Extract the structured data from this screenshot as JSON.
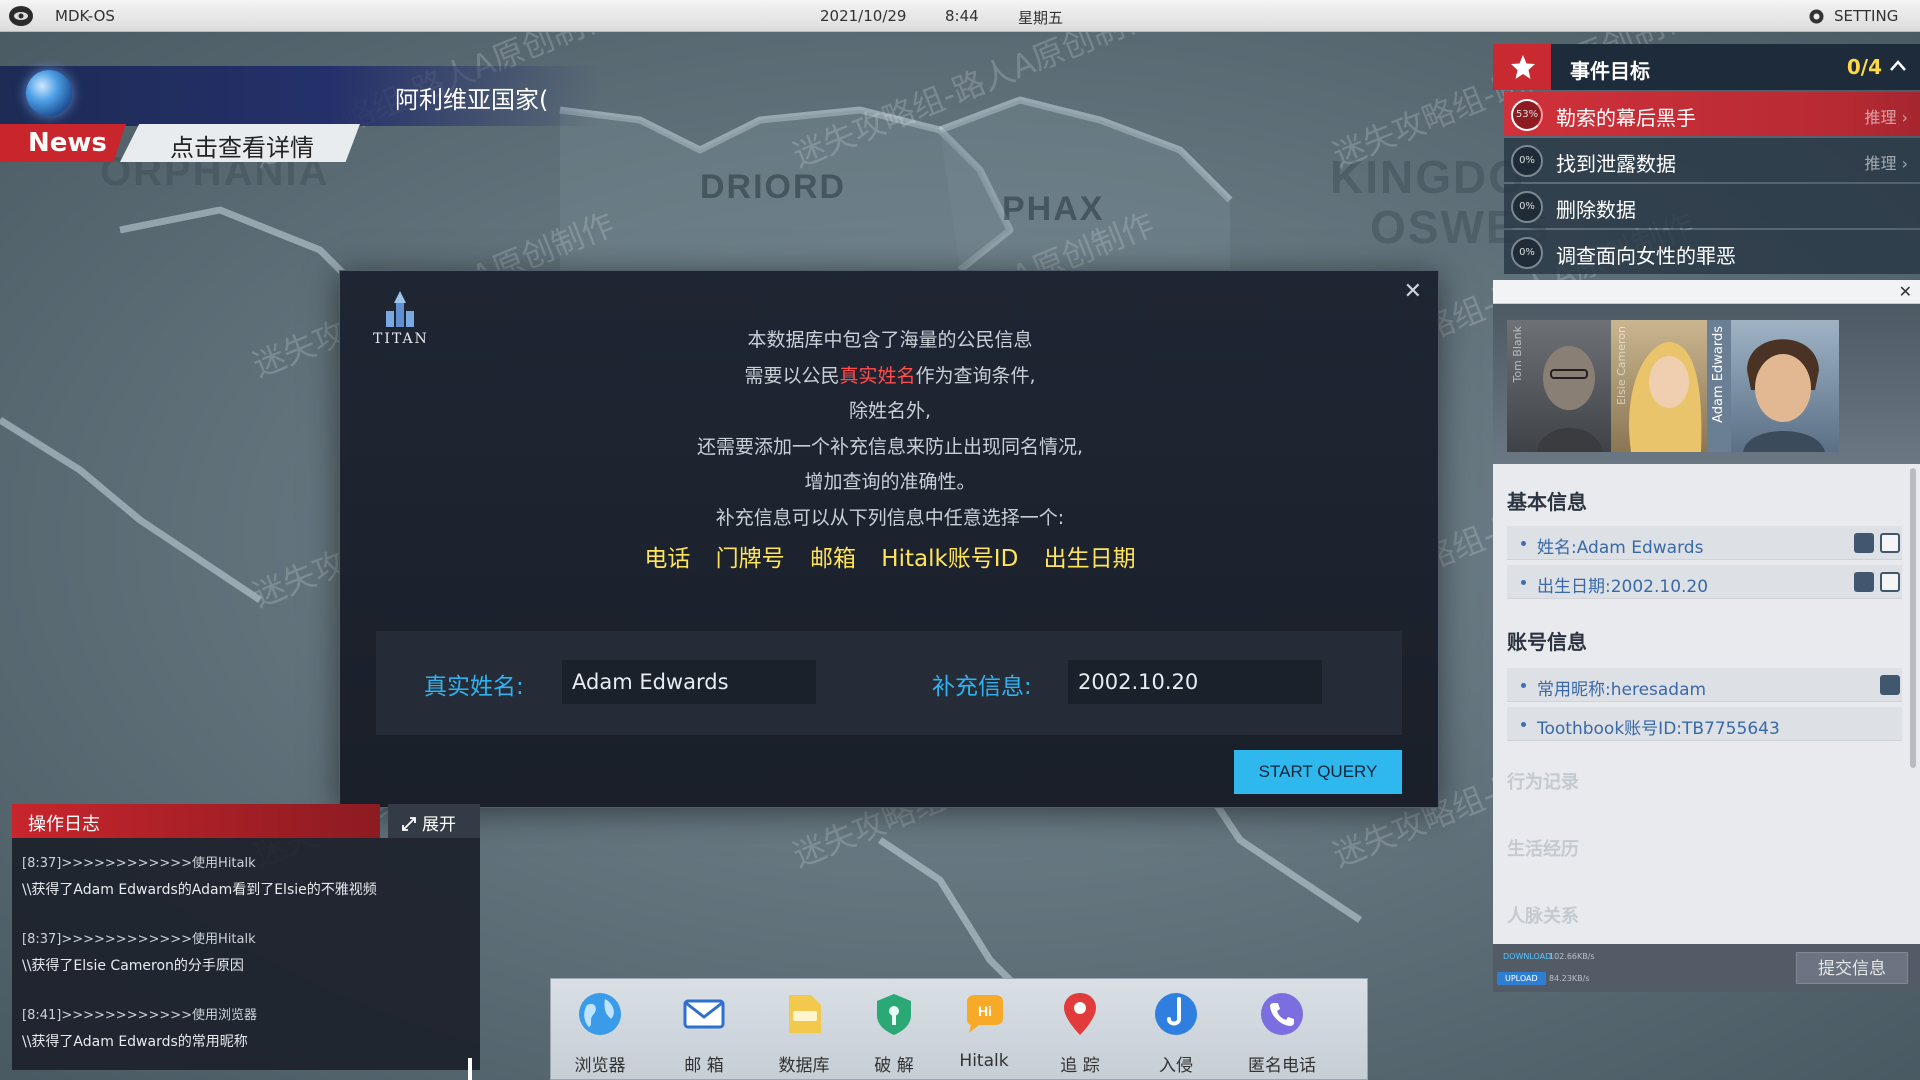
{
  "topbar": {
    "os_name": "MDK-OS",
    "date": "2021/10/29",
    "time": "8:44",
    "weekday": "星期五",
    "setting": "SETTING"
  },
  "news": {
    "headline": "阿利维亚国家(",
    "tag": "News",
    "detail": "点击查看详情"
  },
  "map_labels": [
    "DRIORD",
    "PHAX",
    "KINGDO",
    "OSWES",
    "ORPHANIA"
  ],
  "watermark": "迷失攻略组-路人A原创制作",
  "objectives": {
    "title": "事件目标",
    "count": "0/4",
    "items": [
      {
        "pct": "53%",
        "label": "勒索的幕后黑手",
        "action": "推理",
        "active": true
      },
      {
        "pct": "0%",
        "label": "找到泄露数据",
        "action": "推理",
        "active": false
      },
      {
        "pct": "0%",
        "label": "删除数据",
        "action": "",
        "active": false
      },
      {
        "pct": "0%",
        "label": "调查面向女性的罪恶",
        "action": "",
        "active": false
      }
    ]
  },
  "profile": {
    "portraits": [
      "Tom Blank",
      "Elsie Cameron",
      "Adam Edwards"
    ],
    "basic_title": "基本信息",
    "basic_items": [
      "姓名:Adam Edwards",
      "出生日期:2002.10.20"
    ],
    "account_title": "账号信息",
    "account_items": [
      "常用昵称:heresadam",
      "Toothbook账号ID:TB7755643"
    ],
    "faded_sections": [
      "行为记录",
      "生活经历",
      "人脉关系"
    ],
    "download_label": "DOWNLOAD",
    "download_rate": "102.66KB/s",
    "upload_label": "UPLOAD",
    "upload_rate": "84.23KB/s",
    "submit": "提交信息"
  },
  "modal": {
    "logo_text": "TITAN",
    "intro_lines": [
      "本数据库中包含了海量的公民信息",
      "除姓名外,",
      "还需要添加一个补充信息来防止出现同名情况,",
      "增加查询的准确性。",
      "补充信息可以从下列信息中任意选择一个:"
    ],
    "line2_pre": "需要以公民",
    "line2_red": "真实姓名",
    "line2_post": "作为查询条件,",
    "options": [
      "电话",
      "门牌号",
      "邮箱",
      "Hitalk账号ID",
      "出生日期"
    ],
    "name_label": "真实姓名:",
    "name_value": "Adam Edwards",
    "extra_label": "补充信息:",
    "extra_value": "2002.10.20",
    "query_button": "START QUERY",
    "accent_color": "#2eb8ee",
    "highlight_color": "#ffe45a"
  },
  "log": {
    "title": "操作日志",
    "expand": "展开",
    "entries": [
      {
        "meta": "[8:37]>>>>>>>>>>>>使用Hitalk",
        "text": "\\\\获得了Adam Edwards的Adam看到了Elsie的不雅视频"
      },
      {
        "meta": "[8:37]>>>>>>>>>>>>使用Hitalk",
        "text": "\\\\获得了Elsie Cameron的分手原因"
      },
      {
        "meta": "[8:41]>>>>>>>>>>>>使用浏览器",
        "text": "\\\\获得了Adam Edwards的常用昵称"
      }
    ]
  },
  "dock": {
    "apps": [
      {
        "label": "浏览器",
        "icon": "globe-icon"
      },
      {
        "label": "邮 箱",
        "icon": "mail-icon"
      },
      {
        "label": "数据库",
        "icon": "database-icon"
      },
      {
        "label": "破 解",
        "icon": "crack-icon"
      },
      {
        "label": "Hitalk",
        "icon": "hitalk-icon"
      },
      {
        "label": "追 踪",
        "icon": "location-pin-icon"
      },
      {
        "label": "入侵",
        "icon": "hook-icon"
      },
      {
        "label": "匿名电话",
        "icon": "phone-icon"
      }
    ]
  }
}
